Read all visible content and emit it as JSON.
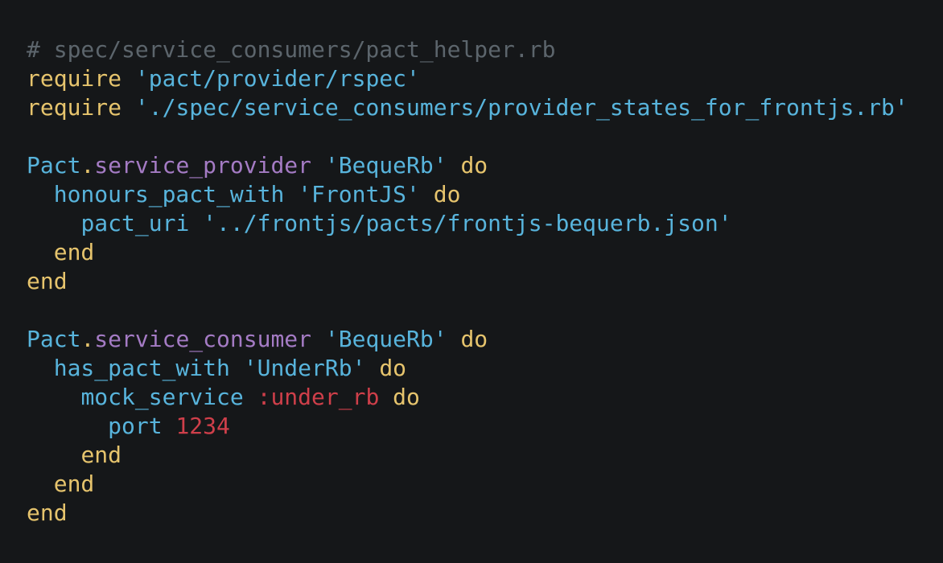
{
  "code": {
    "line1": {
      "comment": "# spec/service_consumers/pact_helper.rb"
    },
    "line2": {
      "keyword": "require",
      "string": "'pact/provider/rspec'"
    },
    "line3": {
      "keyword": "require",
      "string": "'./spec/service_consumers/provider_states_for_frontjs.rb'"
    },
    "line5": {
      "const": "Pact",
      "dot": ".",
      "method": "service_provider",
      "string": "'BequeRb'",
      "do": "do"
    },
    "line6": {
      "ident": "honours_pact_with",
      "string": "'FrontJS'",
      "do": "do"
    },
    "line7": {
      "ident": "pact_uri",
      "string": "'../frontjs/pacts/frontjs-bequerb.json'"
    },
    "line8": {
      "end": "end"
    },
    "line9": {
      "end": "end"
    },
    "line11": {
      "const": "Pact",
      "dot": ".",
      "method": "service_consumer",
      "string": "'BequeRb'",
      "do": "do"
    },
    "line12": {
      "ident": "has_pact_with",
      "string": "'UnderRb'",
      "do": "do"
    },
    "line13": {
      "ident": "mock_service",
      "symbol": ":under_rb",
      "do": "do"
    },
    "line14": {
      "ident": "port",
      "number": "1234"
    },
    "line15": {
      "end": "end"
    },
    "line16": {
      "end": "end"
    },
    "line17": {
      "end": "end"
    }
  },
  "colors": {
    "background": "#151719",
    "comment": "#5c656c",
    "keyword": "#e6c46d",
    "string": "#58b4dc",
    "method": "#a47bc4",
    "symbol_number": "#cf3f4a"
  }
}
